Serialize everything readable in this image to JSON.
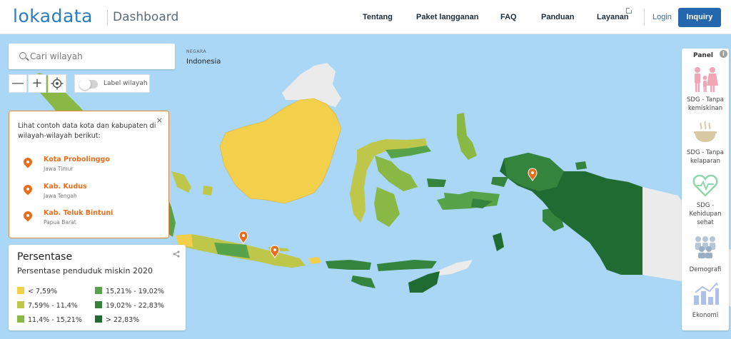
{
  "header": {
    "logo": "lokadata",
    "title": "Dashboard",
    "nav": [
      "Tentang",
      "Paket langganan",
      "FAQ",
      "Panduan",
      "Layanan"
    ],
    "login": "Login",
    "inquiry": "Inquiry"
  },
  "search": {
    "placeholder": "Cari wilayah"
  },
  "controls": {
    "zoom_out": "—",
    "zoom_in": "+",
    "toggle_label": "Label wilayah"
  },
  "region": {
    "label": "NEGARA",
    "value": "Indonesia"
  },
  "examples": {
    "close": "×",
    "intro": "Lihat contoh data kota dan kabupaten di wilayah-wilayah berikut:",
    "items": [
      {
        "name": "Kota Probolinggo",
        "province": "Jawa Timur"
      },
      {
        "name": "Kab. Kudus",
        "province": "Jawa Tengah"
      },
      {
        "name": "Kab. Teluk Bintuni",
        "province": "Papua Barat"
      }
    ]
  },
  "legend": {
    "title": "Persentase",
    "subtitle": "Persentase penduduk miskin 2020",
    "items": [
      {
        "label": "< 7,59%",
        "color": "#f2d04b"
      },
      {
        "label": "7,59% - 11,4%",
        "color": "#bfc74a"
      },
      {
        "label": "11,4% - 15,21%",
        "color": "#8ab845"
      },
      {
        "label": "15,21% - 19,02%",
        "color": "#57a34a"
      },
      {
        "label": "19,02% - 22,83%",
        "color": "#34843d"
      },
      {
        "label": "> 22,83%",
        "color": "#1f6b32"
      }
    ]
  },
  "panel": {
    "title": "Panel",
    "info": "i",
    "items": [
      {
        "label": "SDG - Tanpa kemiskinan",
        "icon": "family-icon"
      },
      {
        "label": "SDG - Tanpa kelaparan",
        "icon": "food-bowl-icon"
      },
      {
        "label": "SDG - Kehidupan sehat",
        "icon": "heart-pulse-icon"
      },
      {
        "label": "Demografi",
        "icon": "people-group-icon"
      },
      {
        "label": "Ekonomi",
        "icon": "bar-chart-growth-icon"
      }
    ]
  },
  "colors": {
    "sea": "#a9d7f5",
    "foreign_land": "#ebebeb",
    "accent": "#2467ad",
    "marker": "#e96d1d"
  }
}
